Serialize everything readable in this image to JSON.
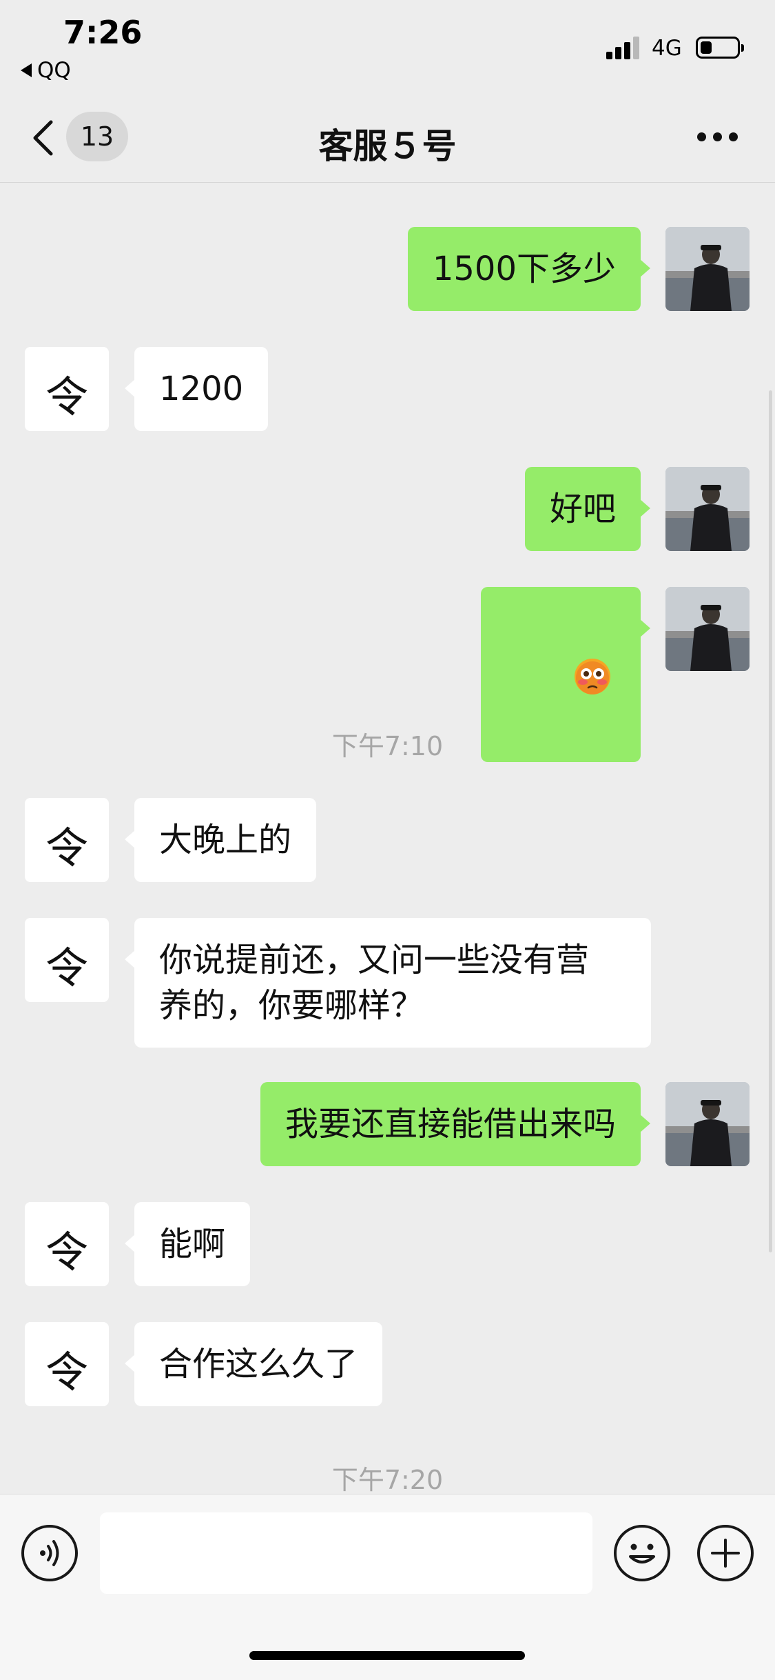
{
  "status_bar": {
    "time": "7:26",
    "back_app": "QQ",
    "network": "4G",
    "battery_level": 0.3
  },
  "nav": {
    "unread_count": "13",
    "title": "客服５号"
  },
  "messages": [
    {
      "side": "right",
      "text": "1500下多少"
    },
    {
      "side": "left",
      "text": "1200",
      "avatar_glyph": "令"
    },
    {
      "side": "right",
      "text": "好吧"
    },
    {
      "side": "right",
      "emoji": "flushed-face"
    },
    {
      "type": "timestamp",
      "text": "下午7:10"
    },
    {
      "side": "left",
      "text": "大晚上的",
      "avatar_glyph": "令"
    },
    {
      "side": "left",
      "text": "你说提前还，又问一些没有营\n养的，你要哪样？",
      "avatar_glyph": "令"
    },
    {
      "side": "right",
      "text": "我要还直接能借出来吗"
    },
    {
      "side": "left",
      "text": "能啊",
      "avatar_glyph": "令"
    },
    {
      "side": "left",
      "text": "合作这么久了",
      "avatar_glyph": "令"
    },
    {
      "type": "timestamp",
      "text": "下午7:20"
    }
  ],
  "colors": {
    "background": "#ededed",
    "outgoing_bubble": "#95ec69",
    "incoming_bubble": "#ffffff",
    "timestamp_text": "#a6a6a6"
  },
  "icons": {
    "back": "chevron-left-icon",
    "more": "more-dots-icon",
    "voice": "voice-icon",
    "emoji": "smiley-icon",
    "plus": "plus-icon"
  }
}
